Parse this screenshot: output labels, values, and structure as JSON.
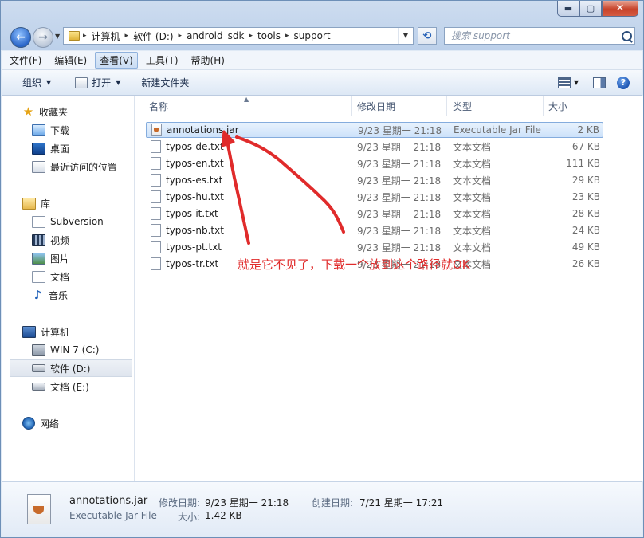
{
  "window": {
    "caption_min": "▬",
    "caption_max": "▢",
    "caption_close": "✕"
  },
  "address": {
    "segments": [
      "计算机",
      "软件 (D:)",
      "android_sdk",
      "tools",
      "support"
    ]
  },
  "search": {
    "placeholder": "搜索 support"
  },
  "menubar": [
    "文件(F)",
    "编辑(E)",
    "查看(V)",
    "工具(T)",
    "帮助(H)"
  ],
  "toolbar": {
    "organize": "组织",
    "open": "打开",
    "new_folder": "新建文件夹"
  },
  "nav": {
    "favorites": {
      "label": "收藏夹",
      "items": [
        "下载",
        "桌面",
        "最近访问的位置"
      ]
    },
    "libraries": {
      "label": "库",
      "items": [
        "Subversion",
        "视频",
        "图片",
        "文档",
        "音乐"
      ]
    },
    "computer": {
      "label": "计算机",
      "items": [
        "WIN 7 (C:)",
        "软件 (D:)",
        "文档 (E:)"
      ]
    },
    "network": {
      "label": "网络"
    }
  },
  "columns": {
    "name": "名称",
    "date": "修改日期",
    "type": "类型",
    "size": "大小"
  },
  "files": [
    {
      "name": "annotations.jar",
      "date": "9/23 星期一 21:18",
      "type": "Executable Jar File",
      "size": "2 KB"
    },
    {
      "name": "typos-de.txt",
      "date": "9/23 星期一 21:18",
      "type": "文本文档",
      "size": "67 KB"
    },
    {
      "name": "typos-en.txt",
      "date": "9/23 星期一 21:18",
      "type": "文本文档",
      "size": "111 KB"
    },
    {
      "name": "typos-es.txt",
      "date": "9/23 星期一 21:18",
      "type": "文本文档",
      "size": "29 KB"
    },
    {
      "name": "typos-hu.txt",
      "date": "9/23 星期一 21:18",
      "type": "文本文档",
      "size": "23 KB"
    },
    {
      "name": "typos-it.txt",
      "date": "9/23 星期一 21:18",
      "type": "文本文档",
      "size": "28 KB"
    },
    {
      "name": "typos-nb.txt",
      "date": "9/23 星期一 21:18",
      "type": "文本文档",
      "size": "24 KB"
    },
    {
      "name": "typos-pt.txt",
      "date": "9/23 星期一 21:18",
      "type": "文本文档",
      "size": "49 KB"
    },
    {
      "name": "typos-tr.txt",
      "date": "9/23 星期一 21:18",
      "type": "文本文档",
      "size": "26 KB"
    }
  ],
  "annotation": {
    "text": "就是它不见了，下载一个放到这个路径就OK",
    "color": "#e02b2b"
  },
  "details": {
    "name": "annotations.jar",
    "type": "Executable Jar File",
    "modified_label": "修改日期:",
    "modified": "9/23 星期一 21:18",
    "size_label": "大小:",
    "size": "1.42 KB",
    "created_label": "创建日期:",
    "created": "7/21 星期一 17:21"
  }
}
